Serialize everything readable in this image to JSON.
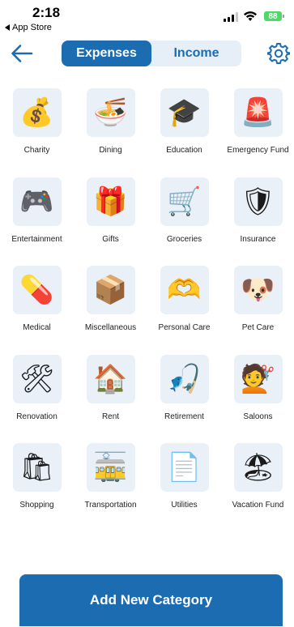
{
  "status_bar": {
    "time": "2:18",
    "back_label": "App Store",
    "battery": "88"
  },
  "header": {
    "tabs": [
      {
        "label": "Expenses",
        "active": true
      },
      {
        "label": "Income",
        "active": false
      }
    ]
  },
  "categories": [
    {
      "label": "Charity",
      "icon": "money-bag-icon",
      "glyph": "💰"
    },
    {
      "label": "Dining",
      "icon": "bowl-icon",
      "glyph": "🍜"
    },
    {
      "label": "Education",
      "icon": "graduation-cap-icon",
      "glyph": "🎓"
    },
    {
      "label": "Emergency Fund",
      "icon": "siren-icon",
      "glyph": "🚨"
    },
    {
      "label": "Entertainment",
      "icon": "game-controller-icon",
      "glyph": "🎮"
    },
    {
      "label": "Gifts",
      "icon": "gift-icon",
      "glyph": "🎁"
    },
    {
      "label": "Groceries",
      "icon": "shopping-cart-icon",
      "glyph": "🛒"
    },
    {
      "label": "Insurance",
      "icon": "shield-icon",
      "glyph": "🛡"
    },
    {
      "label": "Medical",
      "icon": "pill-icon",
      "glyph": "💊"
    },
    {
      "label": "Miscellaneous",
      "icon": "package-icon",
      "glyph": "📦"
    },
    {
      "label": "Personal Care",
      "icon": "heart-hands-icon",
      "glyph": "🫶"
    },
    {
      "label": "Pet Care",
      "icon": "dog-icon",
      "glyph": "🐶"
    },
    {
      "label": "Renovation",
      "icon": "tools-icon",
      "glyph": "🛠"
    },
    {
      "label": "Rent",
      "icon": "house-icon",
      "glyph": "🏠"
    },
    {
      "label": "Retirement",
      "icon": "fishing-icon",
      "glyph": "🎣"
    },
    {
      "label": "Saloons",
      "icon": "haircut-icon",
      "glyph": "💇"
    },
    {
      "label": "Shopping",
      "icon": "shopping-bags-icon",
      "glyph": "🛍"
    },
    {
      "label": "Transportation",
      "icon": "tram-icon",
      "glyph": "🚋"
    },
    {
      "label": "Utilities",
      "icon": "document-icon",
      "glyph": "📄"
    },
    {
      "label": "Vacation Fund",
      "icon": "beach-icon",
      "glyph": "🏖"
    }
  ],
  "footer": {
    "add_label": "Add New Category"
  },
  "colors": {
    "accent": "#1b6cb1",
    "tile_bg": "#e9f0f8",
    "segment_bg": "#e6eef7"
  }
}
